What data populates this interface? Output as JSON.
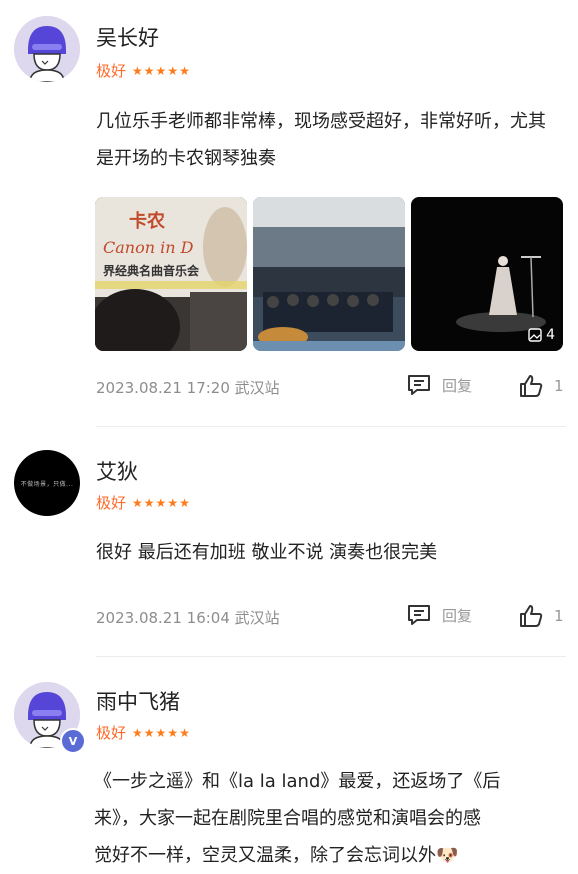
{
  "reviews": [
    {
      "username": "吴长好",
      "rating_label": "极好",
      "stars": 5,
      "content": "几位乐手老师都非常棒，现场感受超好，非常好听，尤其是开场的卡农钢琴独奏",
      "photo_poster_text_1": "卡农",
      "photo_poster_text_2": "Canon in D",
      "photo_poster_text_3": "界经典名曲音乐会",
      "photo_count": "4",
      "meta": "2023.08.21 17:20 武汉站",
      "reply_label": "回复",
      "likes": "1"
    },
    {
      "username": "艾狄",
      "rating_label": "极好",
      "stars": 5,
      "avatar_text": "不做场景，只做...",
      "content": "很好 最后还有加班 敬业不说 演奏也很完美",
      "meta": "2023.08.21 16:04 武汉站",
      "reply_label": "回复",
      "likes": "1"
    },
    {
      "username": "雨中飞猪",
      "rating_label": "极好",
      "stars": 5,
      "badge": "V",
      "content_line1": "《一步之遥》和《la la land》最爱，还返场了《后",
      "content_line2": "来》，大家一起在剧院里合唱的感觉和演唱会的感",
      "content_line3": "觉好不一样，空灵又温柔，除了会忘词以外",
      "emoji": "🐶"
    }
  ]
}
